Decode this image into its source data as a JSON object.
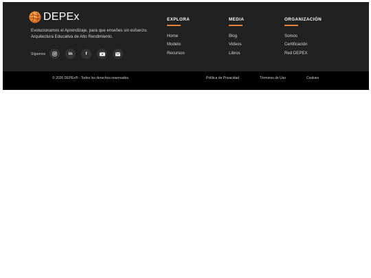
{
  "brand": {
    "name": "DEPEx",
    "tagline_line1": "Evolucionamos el Aprendizaje, para que enseñes sin esfuerzo.",
    "tagline_line2": "Arquitectura Educativa de Alto Rendimiento.",
    "logo_icon": "globe-logo-icon"
  },
  "social": {
    "label": "Síguenos",
    "icons": [
      "instagram-icon",
      "linkedin-icon",
      "facebook-icon",
      "youtube-icon",
      "email-icon"
    ],
    "linkedin_text": "in",
    "facebook_text": "f"
  },
  "columns": [
    {
      "title": "EXPLORA",
      "links": [
        "Home",
        "Modelo",
        "Recursos"
      ]
    },
    {
      "title": "MEDIA",
      "links": [
        "Blog",
        "Videos",
        "Libros"
      ]
    },
    {
      "title": "ORGANIZACIÓN",
      "links": [
        "Somos",
        "Certificación",
        "Red DEPEX"
      ]
    }
  ],
  "bottom": {
    "copyright": "© 2026 DEPEx® - Todos los derechos reservados.",
    "privacy": "Política de Privacidad",
    "terms": "Términos de Uso",
    "cookies": "Cookies"
  },
  "colors": {
    "footer_bg": "#212121",
    "bottom_bg": "#000000",
    "accent": "#e8833a",
    "social_button_bg": "#333333"
  }
}
